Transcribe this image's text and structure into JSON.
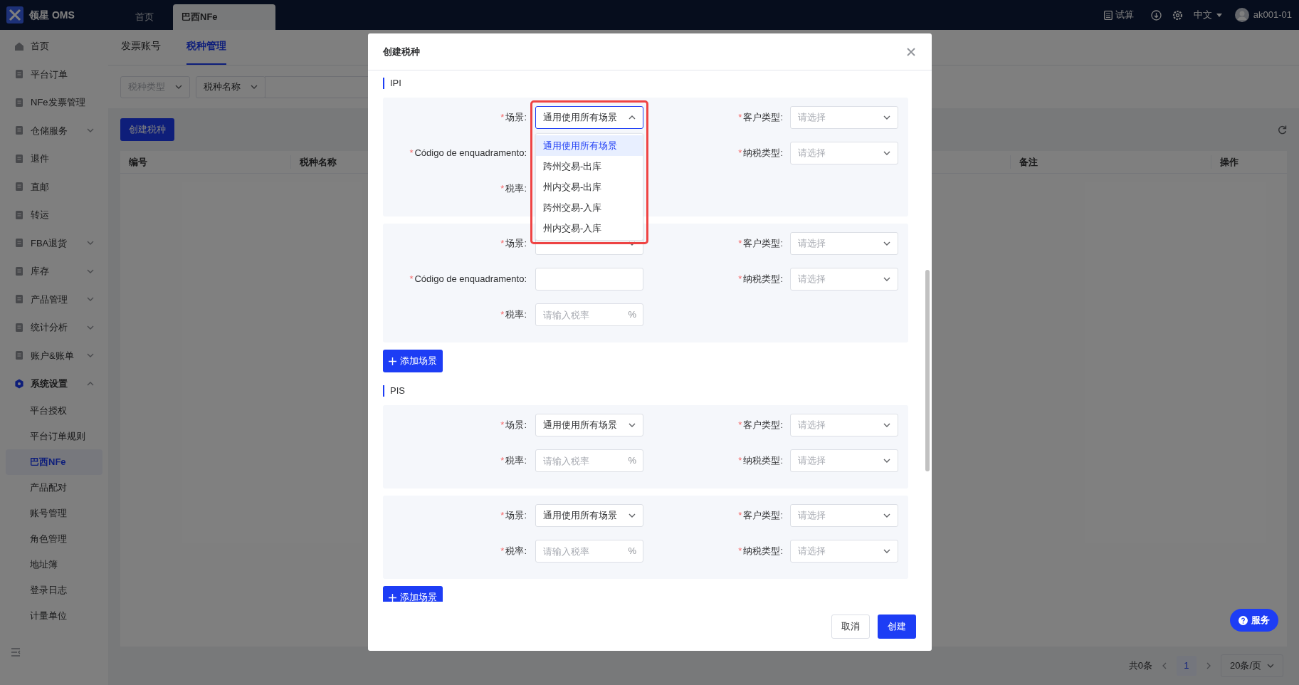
{
  "app": {
    "brand": "领星 OMS",
    "tabs": [
      {
        "label": "首页",
        "selected": false
      },
      {
        "label": "巴西NFe",
        "selected": true
      }
    ],
    "tools": {
      "calc": "试算",
      "language": "中文",
      "user": "ak001-01"
    }
  },
  "sidebar": {
    "items": [
      {
        "label": "首页",
        "kind": "link"
      },
      {
        "label": "平台订单",
        "kind": "link"
      },
      {
        "label": "NFe发票管理",
        "kind": "link"
      },
      {
        "label": "仓储服务",
        "kind": "group",
        "expanded": false
      },
      {
        "label": "退件",
        "kind": "link"
      },
      {
        "label": "直邮",
        "kind": "link"
      },
      {
        "label": "转运",
        "kind": "link"
      },
      {
        "label": "FBA退货",
        "kind": "group",
        "expanded": false
      },
      {
        "label": "库存",
        "kind": "group",
        "expanded": false
      },
      {
        "label": "产品管理",
        "kind": "group",
        "expanded": false
      },
      {
        "label": "统计分析",
        "kind": "group",
        "expanded": false
      },
      {
        "label": "账户&账单",
        "kind": "group",
        "expanded": false
      },
      {
        "label": "系统设置",
        "kind": "group",
        "expanded": true,
        "children": [
          {
            "label": "平台授权",
            "selected": false
          },
          {
            "label": "平台订单规则",
            "selected": false
          },
          {
            "label": "巴西NFe",
            "selected": true
          },
          {
            "label": "产品配对",
            "selected": false
          },
          {
            "label": "账号管理",
            "selected": false
          },
          {
            "label": "角色管理",
            "selected": false
          },
          {
            "label": "地址簿",
            "selected": false
          },
          {
            "label": "登录日志",
            "selected": false
          },
          {
            "label": "计量单位",
            "selected": false
          }
        ]
      }
    ]
  },
  "content": {
    "tabs": [
      {
        "label": "发票账号",
        "selected": false
      },
      {
        "label": "税种管理",
        "selected": true
      }
    ],
    "filters": [
      {
        "placeholder": "税种类型"
      },
      {
        "value": "税种名称"
      }
    ],
    "create_button": "创建税种",
    "table": {
      "columns": [
        "编号",
        "税种名称",
        "备注",
        "操作"
      ]
    },
    "pagination": {
      "total": "共0条",
      "page": "1",
      "page_size": "20条/页"
    }
  },
  "service_button": "服务",
  "dialog": {
    "title": "创建税种",
    "sections": [
      {
        "title": "IPI",
        "groups": [
          {
            "rows": [
              [
                {
                  "label": "场景:",
                  "required": true,
                  "kind": "select",
                  "value": "通用使用所有场景",
                  "open": true
                },
                {
                  "label": "客户类型:",
                  "required": true,
                  "kind": "select",
                  "placeholder": "请选择",
                  "open": false
                }
              ],
              [
                {
                  "label": "Código de enquadramento:",
                  "required": true,
                  "kind": "covered"
                },
                {
                  "label": "纳税类型:",
                  "required": true,
                  "kind": "select",
                  "placeholder": "请选择",
                  "open": false
                }
              ],
              [
                {
                  "label": "税率:",
                  "required": true,
                  "kind": "covered"
                }
              ]
            ]
          },
          {
            "rows": [
              [
                {
                  "label": "场景:",
                  "required": true,
                  "kind": "select",
                  "open": false
                },
                {
                  "label": "客户类型:",
                  "required": true,
                  "kind": "select",
                  "placeholder": "请选择",
                  "open": false
                }
              ],
              [
                {
                  "label": "Código de enquadramento:",
                  "required": true,
                  "kind": "text"
                },
                {
                  "label": "纳税类型:",
                  "required": true,
                  "kind": "select",
                  "placeholder": "请选择",
                  "open": false
                }
              ],
              [
                {
                  "label": "税率:",
                  "required": true,
                  "kind": "percent",
                  "placeholder": "请输入税率",
                  "suffix": "%"
                }
              ]
            ]
          }
        ],
        "add_button": "添加场景"
      },
      {
        "title": "PIS",
        "groups": [
          {
            "rows": [
              [
                {
                  "label": "场景:",
                  "required": true,
                  "kind": "select",
                  "value": "通用使用所有场景",
                  "open": false
                },
                {
                  "label": "客户类型:",
                  "required": true,
                  "kind": "select",
                  "placeholder": "请选择",
                  "open": false
                }
              ],
              [
                {
                  "label": "税率:",
                  "required": true,
                  "kind": "percent",
                  "placeholder": "请输入税率",
                  "suffix": "%"
                },
                {
                  "label": "纳税类型:",
                  "required": true,
                  "kind": "select",
                  "placeholder": "请选择",
                  "open": false
                }
              ]
            ]
          },
          {
            "rows": [
              [
                {
                  "label": "场景:",
                  "required": true,
                  "kind": "select",
                  "value": "通用使用所有场景",
                  "open": false
                },
                {
                  "label": "客户类型:",
                  "required": true,
                  "kind": "select",
                  "placeholder": "请选择",
                  "open": false
                }
              ],
              [
                {
                  "label": "税率:",
                  "required": true,
                  "kind": "percent",
                  "placeholder": "请输入税率",
                  "suffix": "%"
                },
                {
                  "label": "纳税类型:",
                  "required": true,
                  "kind": "select",
                  "placeholder": "请选择",
                  "open": false
                }
              ]
            ]
          }
        ],
        "add_button": "添加场景"
      }
    ],
    "dropdown": {
      "options": [
        {
          "label": "通用使用所有场景",
          "selected": true
        },
        {
          "label": "跨州交易-出库",
          "selected": false
        },
        {
          "label": "州内交易-出库",
          "selected": false
        },
        {
          "label": "跨州交易-入库",
          "selected": false
        },
        {
          "label": "州内交易-入库",
          "selected": false
        }
      ]
    },
    "required_mark": "*",
    "buttons": {
      "cancel": "取消",
      "confirm": "创建"
    }
  }
}
